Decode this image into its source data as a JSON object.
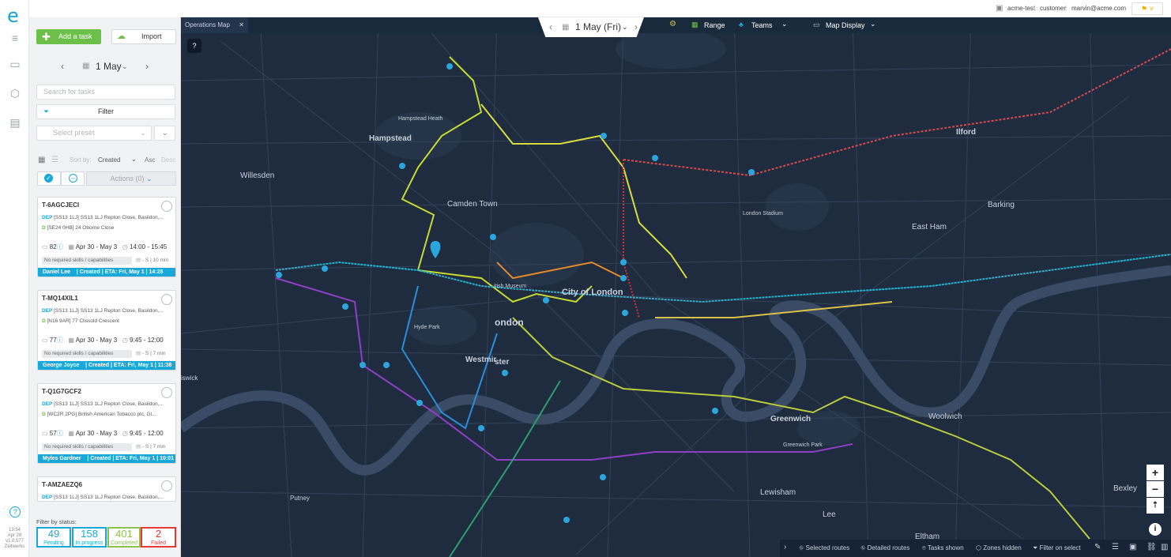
{
  "colors": {
    "accent": "#1aa8d8",
    "add": "#6cc04a",
    "map_bg": "#1f2c40"
  },
  "rail": {
    "version_lines": [
      "13:54",
      "Apr 28",
      "v1.0.577",
      "Zeitwerks"
    ]
  },
  "topbar": {
    "account": "acme-test",
    "role": "customer",
    "email": "marvin@acme.com"
  },
  "panel": {
    "add_label": "Add a task",
    "import_label": "Import",
    "date": "1 May",
    "search_placeholder": "Search for tasks",
    "filter_label": "Filter",
    "preset_placeholder": "Select preset",
    "sort_label": "Sort by:",
    "sort_value": "Created",
    "sort_dir": "Asc",
    "sort_desc": "Desc",
    "actions_label": "Actions (0)",
    "tasks": [
      {
        "id": "T-6AGCJECI",
        "dep": "[SS13 1LJ] SS13 1LJ Repton Close, Basildon,...",
        "dest": "[SE24 0HB] 24 Oborne Close",
        "size": "82",
        "dates": "Apr 30 - May 3",
        "time": "14:00 - 15:45",
        "skills": "No required skills / capabilities",
        "dur": "- S | 10 min",
        "driver": "Daniel Lee",
        "status": "| Created | ETA: Fri, May 1 | 14:28"
      },
      {
        "id": "T-MQ14XIL1",
        "dep": "[SS13 1LJ] SS13 1LJ Repton Close, Basildon,...",
        "dest": "[N16 9AR] 77 Clissold Crescent",
        "size": "77",
        "dates": "Apr 30 - May 3",
        "time": "9:45 - 12:00",
        "skills": "No required skills / capabilities",
        "dur": "- S | 7 min",
        "driver": "George Joyce",
        "status": "| Created | ETA: Fri, May 1 | 11:38"
      },
      {
        "id": "T-Q1G7GCF2",
        "dep": "[SS13 1LJ] SS13 1LJ Repton Close, Basildon,...",
        "dest": "[WC2R 2PG] British American Tobacco plc, Gl...",
        "size": "57",
        "dates": "Apr 30 - May 3",
        "time": "9:45 - 12:00",
        "skills": "No required skills / capabilities",
        "dur": "- S | 7 min",
        "driver": "Myles Gardner",
        "status": "| Created | ETA: Fri, May 1 | 10:01"
      },
      {
        "id": "T-AMZAEZQ6",
        "dep": "[SS13 1LJ] SS13 1LJ Repton Close, Basildon,...",
        "dest": "",
        "size": "",
        "dates": "",
        "time": "",
        "skills": "",
        "dur": "",
        "driver": "",
        "status": ""
      }
    ],
    "filter_status_label": "Filter by status:",
    "stats": [
      {
        "n": "49",
        "t": "Pending",
        "c": "#1aa8d8"
      },
      {
        "n": "158",
        "t": "In progress",
        "c": "#1aa8d8"
      },
      {
        "n": "401",
        "t": "Completed",
        "c": "#8bc34a"
      },
      {
        "n": "2",
        "t": "Failed",
        "c": "#e53935"
      }
    ]
  },
  "map": {
    "tab_label": "Operations Map",
    "date_label": "1 May (Fri)",
    "range_label": "Range",
    "teams_label": "Teams",
    "display_label": "Map Display",
    "places": [
      "Hampstead",
      "Willesden",
      "Camden Town",
      "City of London",
      "ondon",
      "Westmir",
      "ster",
      "Ilford",
      "Barking",
      "East Ham",
      "Greenwich",
      "Woolwich",
      "Lewisham",
      "Lee",
      "Putney",
      "Eltham",
      "Bexley",
      "Hampstead Heath",
      "London Stadium",
      "Hyde Park",
      "Greenwich Park",
      "itish Museum",
      "iswick"
    ],
    "footer": [
      "Selected routes",
      "Detailed routes",
      "Tasks shown",
      "Zones hidden",
      "Filter on select"
    ]
  }
}
